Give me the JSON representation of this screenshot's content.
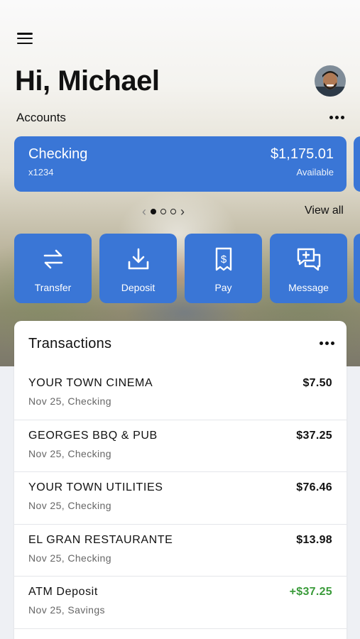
{
  "header": {
    "greeting": "Hi, Michael"
  },
  "accounts": {
    "label": "Accounts",
    "card": {
      "name": "Checking",
      "number": "x1234",
      "balance": "$1,175.01",
      "balance_label": "Available"
    },
    "pager": {
      "pages": 3,
      "active": 1
    },
    "view_all": "View all"
  },
  "actions": [
    {
      "label": "Transfer",
      "icon": "transfer-icon"
    },
    {
      "label": "Deposit",
      "icon": "deposit-icon"
    },
    {
      "label": "Pay",
      "icon": "bill-pay-icon"
    },
    {
      "label": "Message",
      "icon": "message-icon"
    }
  ],
  "transactions": {
    "title": "Transactions",
    "items": [
      {
        "merchant": "YOUR TOWN CINEMA",
        "meta": "Nov 25, Checking",
        "amount": "$7.50",
        "credit": false
      },
      {
        "merchant": "GEORGES BBQ & PUB",
        "meta": "Nov 25, Checking",
        "amount": "$37.25",
        "credit": false
      },
      {
        "merchant": "YOUR TOWN UTILITIES",
        "meta": "Nov 25, Checking",
        "amount": "$76.46",
        "credit": false
      },
      {
        "merchant": "EL GRAN RESTAURANTE",
        "meta": "Nov 25, Checking",
        "amount": "$13.98",
        "credit": false
      },
      {
        "merchant": "ATM Deposit",
        "meta": "Nov 25, Savings",
        "amount": "+$37.25",
        "credit": true
      }
    ]
  },
  "colors": {
    "accent": "#3a76d6",
    "credit": "#3a9b3a"
  }
}
